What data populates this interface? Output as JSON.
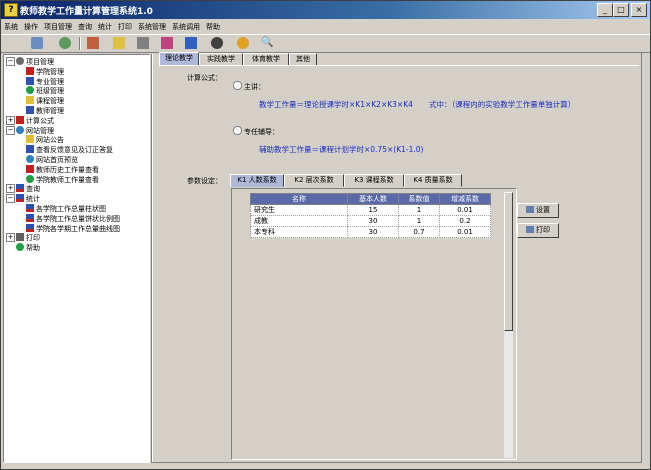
{
  "window": {
    "title": "教师教学工作量计算管理系统1.0"
  },
  "menu": [
    "系统",
    "操作",
    "项目管理",
    "查询",
    "统计",
    "打印",
    "系统管理",
    "系统调用",
    "帮助"
  ],
  "tree": [
    {
      "label": "项目管理",
      "level": 0,
      "expander": "−",
      "icon": "ni-proj"
    },
    {
      "label": "学院管理",
      "level": 1,
      "icon": "ni-red"
    },
    {
      "label": "专业管理",
      "level": 1,
      "icon": "ni-blue"
    },
    {
      "label": "班级管理",
      "level": 1,
      "icon": "ni-grn"
    },
    {
      "label": "课程管理",
      "level": 1,
      "icon": "ni-yel"
    },
    {
      "label": "教师管理",
      "level": 1,
      "icon": "ni-blue"
    },
    {
      "label": "计算公式",
      "level": 0,
      "expander": "+",
      "icon": "ni-red"
    },
    {
      "label": "网站管理",
      "level": 0,
      "expander": "−",
      "icon": "ni-web"
    },
    {
      "label": "网站公告",
      "level": 1,
      "icon": "ni-yel"
    },
    {
      "label": "查看反馈意见及订正答复",
      "level": 1,
      "icon": "ni-blue"
    },
    {
      "label": "网站首页预览",
      "level": 1,
      "icon": "ni-web"
    },
    {
      "label": "教师历史工作量查看",
      "level": 1,
      "icon": "ni-red"
    },
    {
      "label": "学院教师工作量查看",
      "level": 1,
      "icon": "ni-grn"
    },
    {
      "label": "查询",
      "level": 0,
      "expander": "+",
      "icon": "ni-chart"
    },
    {
      "label": "统计",
      "level": 0,
      "expander": "−",
      "icon": "ni-chart"
    },
    {
      "label": "各学院工作总量柱状图",
      "level": 1,
      "icon": "ni-chart"
    },
    {
      "label": "各学院工作总量饼状比例图",
      "level": 1,
      "icon": "ni-chart"
    },
    {
      "label": "学院各学期工作总量曲线图",
      "level": 1,
      "icon": "ni-chart"
    },
    {
      "label": "打印",
      "level": 0,
      "expander": "+",
      "icon": "ni-print"
    },
    {
      "label": "帮助",
      "level": 0,
      "icon": "ni-help"
    }
  ],
  "top_tabs": [
    "理论教学",
    "实践教学",
    "体育教学",
    "其他"
  ],
  "formula": {
    "label": "计算公式：",
    "main_label": "主讲：",
    "main_formula": "教学工作量＝理论授课学时×K1×K2×K3×K4",
    "main_note": "式中：（课程内的实验教学工作量单独计算）",
    "assist_label": "专任辅导：",
    "assist_formula": "辅助教学工作量＝课程计划学时×0.75×(K1-1.0)"
  },
  "params": {
    "label": "参数设定：",
    "tabs": [
      "K1 人数系数",
      "K2 层次系数",
      "K3 课程系数",
      "K4 质量系数"
    ],
    "columns": [
      "名称",
      "基本人数",
      "系数值",
      "增减系数"
    ],
    "rows": [
      [
        "研究生",
        "15",
        "1",
        "0.01"
      ],
      [
        "成教",
        "30",
        "1",
        "0.2"
      ],
      [
        "本专科",
        "30",
        "0.7",
        "0.01"
      ]
    ]
  },
  "buttons": {
    "settings": "设置",
    "print": "打印"
  }
}
